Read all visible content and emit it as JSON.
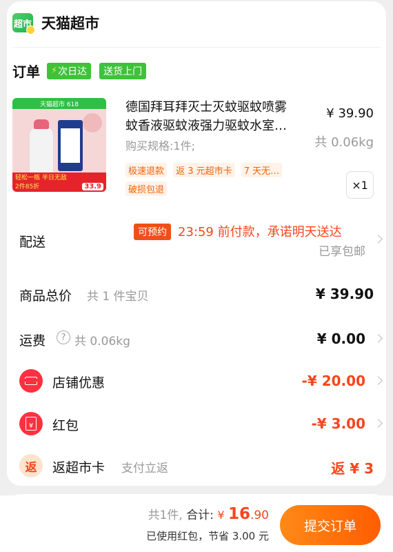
{
  "store": {
    "logo_text": "超市",
    "name": "天猫超市"
  },
  "order": {
    "label": "订单",
    "tags": [
      "次日达",
      "送货上门"
    ]
  },
  "product": {
    "image_top_text": "天猫超市 618",
    "image_bottom_text": "轻松一瓶 半日无敌",
    "image_promo": "2件85折",
    "image_price": "33.9",
    "title_line1": "德国拜耳拜灭士灭蚊驱蚊喷雾",
    "title_line2": "蚊香液驱蚊液强力驱蚊水室…",
    "price": "¥ 39.90",
    "spec": "购买规格:1件;",
    "weight": "共 0.06kg",
    "service_tags": [
      "极速退款",
      "返 3 元超市卡",
      "7 天无…",
      "破损包退"
    ],
    "quantity": "×1"
  },
  "delivery": {
    "label": "配送",
    "badge": "可预约",
    "promise": "23:59 前付款，承诺明天送达",
    "note": "已享包邮"
  },
  "summary": {
    "goods_total_label": "商品总价",
    "goods_total_sub": "共 1 件宝贝",
    "goods_total_value": "¥ 39.90",
    "shipping_label": "运费",
    "shipping_sub": "共 0.06kg",
    "shipping_value": "¥ 0.00",
    "store_discount_label": "店铺优惠",
    "store_discount_value": "-¥ 20.00",
    "red_packet_label": "红包",
    "red_packet_value": "-¥ 3.00",
    "cashback_icon": "返",
    "cashback_label": "返超市卡",
    "cashback_sub": "支付立返",
    "cashback_value": "返 ¥ 3"
  },
  "checkout": {
    "count_text": "共1件,",
    "total_label": "合计:",
    "currency": "¥",
    "total_int": "16",
    "total_dec": ".90",
    "savings": "已使用红包，节省 3.00 元",
    "submit_label": "提交订单"
  },
  "colors": {
    "accent": "#f5461c",
    "brand_green": "#3ec23a",
    "button": "#ff6a00"
  }
}
